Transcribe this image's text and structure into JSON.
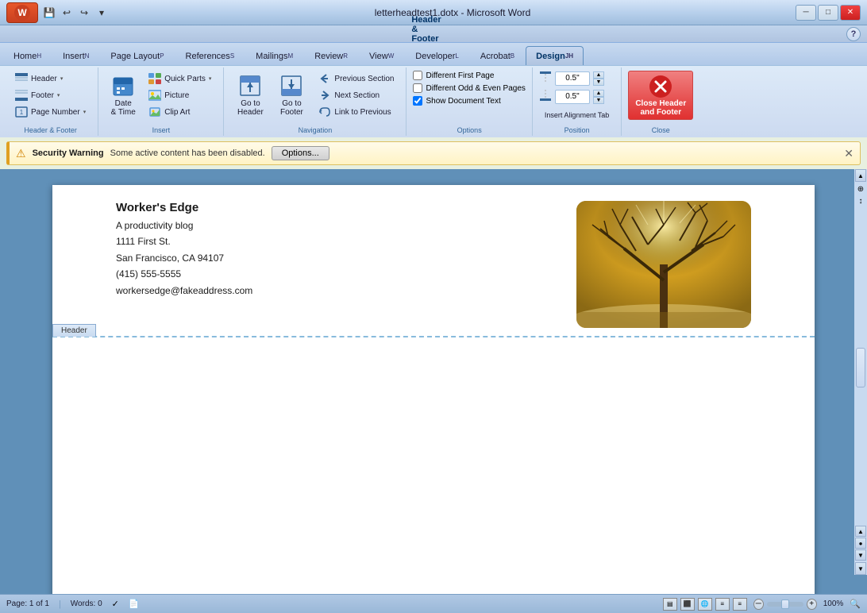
{
  "titlebar": {
    "title": "letterheadtest1.dotx - Microsoft Word",
    "office_btn": "⊞",
    "quick_access": [
      "💾",
      "↩",
      "↪"
    ],
    "window_controls": [
      "─",
      "□",
      "✕"
    ]
  },
  "ribbon": {
    "hf_tools_label": "Header & Footer Tools",
    "tabs": [
      {
        "id": "home",
        "label": "Home",
        "shortcut": "H",
        "active": false
      },
      {
        "id": "insert",
        "label": "Insert",
        "shortcut": "N",
        "active": false
      },
      {
        "id": "page_layout",
        "label": "Page Layout",
        "shortcut": "P",
        "active": false
      },
      {
        "id": "references",
        "label": "References",
        "shortcut": "S",
        "active": false
      },
      {
        "id": "mailings",
        "label": "Mailings",
        "shortcut": "M",
        "active": false
      },
      {
        "id": "review",
        "label": "Review",
        "shortcut": "R",
        "active": false
      },
      {
        "id": "view",
        "label": "View",
        "shortcut": "W",
        "active": false
      },
      {
        "id": "developer",
        "label": "Developer",
        "shortcut": "L",
        "active": false
      },
      {
        "id": "acrobat",
        "label": "Acrobat",
        "shortcut": "B",
        "active": false
      },
      {
        "id": "design",
        "label": "Design",
        "shortcut": "JH",
        "active": true
      }
    ],
    "groups": {
      "header_footer": {
        "label": "Header & Footer",
        "header_btn": "Header",
        "footer_btn": "Footer",
        "page_number_btn": "Page Number"
      },
      "insert": {
        "label": "Insert",
        "date_time_btn": "Date\n& Time",
        "quick_parts_btn": "Quick Parts",
        "picture_btn": "Picture",
        "clip_art_btn": "Clip Art"
      },
      "navigation": {
        "label": "Navigation",
        "go_to_header_btn": "Go to\nHeader",
        "go_to_footer_btn": "Go to\nFooter",
        "previous_section_btn": "Previous Section",
        "next_section_btn": "Next Section",
        "link_to_previous_btn": "Link to Previous"
      },
      "options": {
        "label": "Options",
        "different_first_page": "Different First Page",
        "different_odd_even": "Different Odd & Even Pages",
        "show_document_text": "Show Document Text",
        "show_checked": true
      },
      "position": {
        "label": "Position",
        "value1": "0.5\"",
        "value2": "0.5\""
      },
      "close": {
        "label": "Close",
        "close_btn": "Close Header\nand Footer"
      }
    }
  },
  "security_bar": {
    "title": "Security Warning",
    "message": "Some active content has been disabled.",
    "options_btn": "Options...",
    "close_symbol": "✕"
  },
  "document": {
    "header": {
      "company": "Worker's Edge",
      "tagline": "A productivity blog",
      "address1": "1111 First St.",
      "city_state": "San Francisco, CA 94107",
      "phone": "(415) 555-5555",
      "email": "workersedge@fakeaddress.com",
      "label": "Header"
    },
    "body": {}
  },
  "status_bar": {
    "page": "Page: 1 of 1",
    "words": "Words: 0",
    "zoom": "100%"
  }
}
